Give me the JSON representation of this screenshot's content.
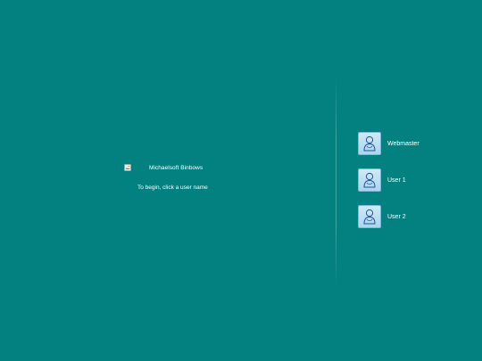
{
  "brand": {
    "name": "Michaelsoft Binbows",
    "logo_icon": "broken-image-icon"
  },
  "instruction": "To begin, click a user name",
  "users": [
    {
      "name": "Webmaster",
      "icon": "user-avatar-icon"
    },
    {
      "name": "User 1",
      "icon": "user-avatar-icon"
    },
    {
      "name": "User 2",
      "icon": "user-avatar-icon"
    }
  ],
  "colors": {
    "background": "#038080",
    "avatar_tile": "#a9d6ee",
    "avatar_outline": "#2a4f9a",
    "text": "#ffffff"
  }
}
